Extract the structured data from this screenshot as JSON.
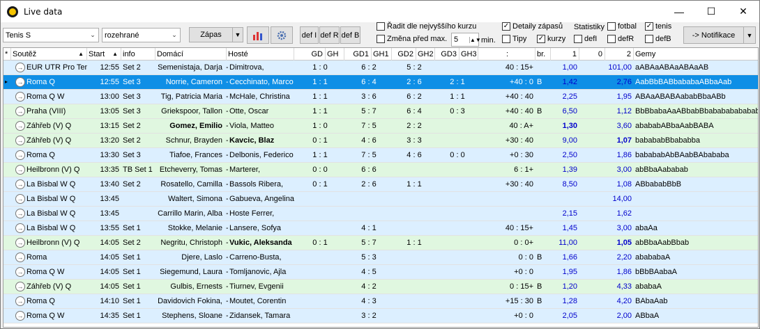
{
  "window": {
    "title": "Live data",
    "minimize": "—",
    "maximize": "☐",
    "close": "✕"
  },
  "toolbar": {
    "sport": "Tenis S",
    "filter": "rozehrané",
    "zapas_label": "Zápas",
    "chart_icon": "bar-chart-icon",
    "settings_icon": "gear-icon",
    "def_i": "def I",
    "def_r": "def R",
    "def_b": "def B",
    "sort_label": "Řadit dle nejvyššího kurzu",
    "change_label": "Změna před max.",
    "change_value": "5",
    "min_label": "min.",
    "detaily_label": "Detaily zápasů",
    "tipy_label": "Tipy",
    "kurzy_label": "kurzy",
    "statistiky_label": "Statistiky",
    "fotbal_label": "fotbal",
    "tenis_label": "tenis",
    "defi_label": "defI",
    "defr_label": "defR",
    "defb_label": "defB",
    "notifikace_label": "-> Notifikace",
    "sort_checked": "",
    "change_checked": "",
    "detaily_checked": "✓",
    "tipy_checked": "",
    "kurzy_checked": "✓",
    "fotbal_checked": "",
    "tenis_checked": "✓",
    "defi_checked": "",
    "defr_checked": "",
    "defb_checked": ""
  },
  "columns": {
    "star": "*",
    "soutez": "Soutěž",
    "start": "Start",
    "info": "info",
    "domaci": "Domácí",
    "hoste": "Hosté",
    "gd": "GD",
    "gh": "GH",
    "gd1": "GD1",
    "gh1": "GH1",
    "gd2": "GD2",
    "gh2": "GH2",
    "gd3": "GD3",
    "gh3": "GH3",
    "score": ":",
    "br": "br.",
    "k1": "1",
    "k0": "0",
    "k2": "2",
    "gemy": "Gemy"
  },
  "rows": [
    {
      "soutez": "EUR UTR Pro Teni",
      "start": "12:55",
      "info": "Set 2",
      "domaci": "Semenistaja, Darja",
      "hoste": "Dimitrova,",
      "g": "1 : 0",
      "g1": "6 : 2",
      "g2": "5 : 2",
      "g3": "",
      "score": "40 : 15+",
      "br": "",
      "k1": "1,00",
      "k0": "",
      "k2": "101,00",
      "gemy": "aABAaABAaABAaAB",
      "color": "blue"
    },
    {
      "soutez": "Roma Q",
      "start": "12:55",
      "info": "Set 3",
      "domaci": "Norrie, Cameron",
      "hoste": "Cecchinato, Marco",
      "g": "1 : 1",
      "g1": "6 : 4",
      "g2": "2 : 6",
      "g3": "2 : 1",
      "score": "+40 : 0",
      "br": "B",
      "k1": "1,42",
      "k0": "",
      "k2": "2,76",
      "gemy": "AabBbBABbababaABbaAab",
      "color": "sel"
    },
    {
      "soutez": "Roma Q W",
      "start": "13:00",
      "info": "Set 3",
      "domaci": "Tig, Patricia Maria",
      "hoste": "McHale, Christina",
      "g": "1 : 1",
      "g1": "3 : 6",
      "g2": "6 : 2",
      "g3": "1 : 1",
      "score": "+40 : 40",
      "br": "",
      "k1": "2,25",
      "k0": "",
      "k2": "1,95",
      "gemy": "ABAaABABAababBbaABb",
      "color": "blue"
    },
    {
      "soutez": "Praha (VIII)",
      "start": "13:05",
      "info": "Set 3",
      "domaci": "Griekspoor, Tallon",
      "hoste": "Otte, Oscar",
      "g": "1 : 1",
      "g1": "5 : 7",
      "g2": "6 : 4",
      "g3": "0 : 3",
      "score": "+40 : 40",
      "br": "B",
      "k1": "6,50",
      "k0": "",
      "k2": "1,12",
      "gemy": "BbBbabaAaABbabBbabababababab",
      "color": "green"
    },
    {
      "soutez": "Záhřeb (V) Q",
      "start": "13:15",
      "info": "Set 2",
      "domaci": "Gomez, Emilio",
      "hoste": "Viola, Matteo",
      "g": "1 : 0",
      "g1": "7 : 5",
      "g2": "2 : 2",
      "g3": "",
      "score": "40 : A+",
      "br": "",
      "k1": "1,30",
      "k0": "",
      "k2": "3,60",
      "gemy": "abababABbaAabBABA",
      "color": "green",
      "bold_home": true,
      "bold_k1": true
    },
    {
      "soutez": "Záhřeb (V) Q",
      "start": "13:20",
      "info": "Set 2",
      "domaci": "Schnur, Brayden",
      "hoste": "Kavcic, Blaz",
      "g": "0 : 1",
      "g1": "4 : 6",
      "g2": "3 : 3",
      "g3": "",
      "score": "+30 : 40",
      "br": "",
      "k1": "9,00",
      "k0": "",
      "k2": "1,07",
      "gemy": "babababBbababba",
      "color": "green",
      "bold_away": true,
      "bold_k2": true
    },
    {
      "soutez": "Roma Q",
      "start": "13:30",
      "info": "Set 3",
      "domaci": "Tiafoe, Frances",
      "hoste": "Delbonis, Federico",
      "g": "1 : 1",
      "g1": "7 : 5",
      "g2": "4 : 6",
      "g3": "0 : 0",
      "score": "+0 : 30",
      "br": "",
      "k1": "2,50",
      "k0": "",
      "k2": "1,86",
      "gemy": "babababAbBAabBAbababa",
      "color": "blue"
    },
    {
      "soutez": "Heilbronn (V) Q",
      "start": "13:35",
      "info": "TB Set 1",
      "domaci": "Etcheverry, Tomas",
      "hoste": "Marterer,",
      "g": "0 : 0",
      "g1": "6 : 6",
      "g2": "",
      "g3": "",
      "score": "6 : 1+",
      "br": "",
      "k1": "1,39",
      "k0": "",
      "k2": "3,00",
      "gemy": "abBbaAababab",
      "color": "green"
    },
    {
      "soutez": "La Bisbal W Q",
      "start": "13:40",
      "info": "Set 2",
      "domaci": "Rosatello, Camilla",
      "hoste": "Bassols Ribera,",
      "g": "0 : 1",
      "g1": "2 : 6",
      "g2": "1 : 1",
      "g3": "",
      "score": "+30 : 40",
      "br": "",
      "k1": "8,50",
      "k0": "",
      "k2": "1,08",
      "gemy": "ABbababBbB",
      "color": "blue"
    },
    {
      "soutez": "La Bisbal W Q",
      "start": "13:45",
      "info": "",
      "domaci": "Waltert, Simona",
      "hoste": "Gabueva, Angelina",
      "g": "",
      "g1": "",
      "g2": "",
      "g3": "",
      "score": "",
      "br": "",
      "k1": "",
      "k0": "",
      "k2": "14,00",
      "gemy": "",
      "color": "blue"
    },
    {
      "soutez": "La Bisbal W Q",
      "start": "13:45",
      "info": "",
      "domaci": "Carrillo Marin, Alba",
      "hoste": "Hoste Ferrer,",
      "g": "",
      "g1": "",
      "g2": "",
      "g3": "",
      "score": "",
      "br": "",
      "k1": "2,15",
      "k0": "",
      "k2": "1,62",
      "gemy": "",
      "color": "blue"
    },
    {
      "soutez": "La Bisbal W Q",
      "start": "13:55",
      "info": "Set 1",
      "domaci": "Stokke, Melanie",
      "hoste": "Lansere, Sofya",
      "g": "",
      "g1": "4 : 1",
      "g2": "",
      "g3": "",
      "score": "40 : 15+",
      "br": "",
      "k1": "1,45",
      "k0": "",
      "k2": "3,00",
      "gemy": "abaAa",
      "color": "blue"
    },
    {
      "soutez": "Heilbronn (V) Q",
      "start": "14:05",
      "info": "Set 2",
      "domaci": "Negritu, Christoph",
      "hoste": "Vukic, Aleksanda",
      "g": "0 : 1",
      "g1": "5 : 7",
      "g2": "1 : 1",
      "g3": "",
      "score": "0 : 0+",
      "br": "",
      "k1": "11,00",
      "k0": "",
      "k2": "1,05",
      "gemy": "abBbaAabBbab",
      "color": "green",
      "bold_away": true,
      "bold_k2": true
    },
    {
      "soutez": "Roma",
      "start": "14:05",
      "info": "Set 1",
      "domaci": "Djere, Laslo",
      "hoste": "Carreno-Busta,",
      "g": "",
      "g1": "5 : 3",
      "g2": "",
      "g3": "",
      "score": "0 : 0",
      "br": "B",
      "k1": "1,66",
      "k0": "",
      "k2": "2,20",
      "gemy": "abababaA",
      "color": "blue"
    },
    {
      "soutez": "Roma Q W",
      "start": "14:05",
      "info": "Set 1",
      "domaci": "Siegemund, Laura",
      "hoste": "Tomljanovic, Ajla",
      "g": "",
      "g1": "4 : 5",
      "g2": "",
      "g3": "",
      "score": "+0 : 0",
      "br": "",
      "k1": "1,95",
      "k0": "",
      "k2": "1,86",
      "gemy": "bBbBAabaA",
      "color": "blue"
    },
    {
      "soutez": "Záhřeb (V) Q",
      "start": "14:05",
      "info": "Set 1",
      "domaci": "Gulbis, Ernests",
      "hoste": "Tiurnev, Evgenii",
      "g": "",
      "g1": "4 : 2",
      "g2": "",
      "g3": "",
      "score": "0 : 15+",
      "br": "B",
      "k1": "1,20",
      "k0": "",
      "k2": "4,33",
      "gemy": "ababaA",
      "color": "green"
    },
    {
      "soutez": "Roma Q",
      "start": "14:10",
      "info": "Set 1",
      "domaci": "Davidovich Fokina,",
      "hoste": "Moutet, Corentin",
      "g": "",
      "g1": "4 : 3",
      "g2": "",
      "g3": "",
      "score": "+15 : 30",
      "br": "B",
      "k1": "1,28",
      "k0": "",
      "k2": "4,20",
      "gemy": "BAbaAab",
      "color": "blue"
    },
    {
      "soutez": "Roma Q W",
      "start": "14:35",
      "info": "Set 1",
      "domaci": "Stephens, Sloane",
      "hoste": "Zidansek, Tamara",
      "g": "",
      "g1": "3 : 2",
      "g2": "",
      "g3": "",
      "score": "+0 : 0",
      "br": "",
      "k1": "2,05",
      "k0": "",
      "k2": "2,00",
      "gemy": "ABbaA",
      "color": "blue"
    }
  ]
}
